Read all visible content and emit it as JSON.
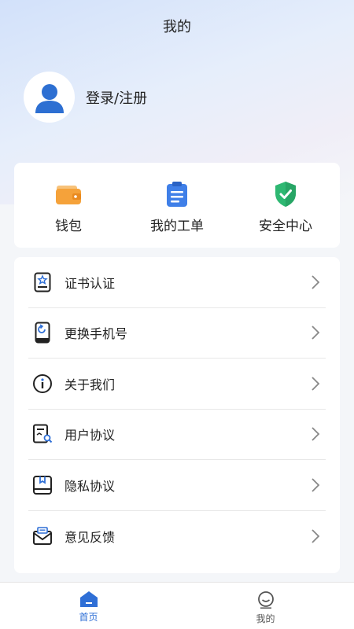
{
  "header": {
    "title": "我的"
  },
  "profile": {
    "login_label": "登录/注册",
    "avatar_icon": "user-avatar-icon"
  },
  "quick_actions": [
    {
      "label": "钱包",
      "icon": "wallet-icon"
    },
    {
      "label": "我的工单",
      "icon": "clipboard-icon"
    },
    {
      "label": "安全中心",
      "icon": "shield-check-icon"
    }
  ],
  "menu": [
    {
      "label": "证书认证",
      "icon": "certificate-icon"
    },
    {
      "label": "更换手机号",
      "icon": "phone-change-icon"
    },
    {
      "label": "关于我们",
      "icon": "info-icon"
    },
    {
      "label": "用户协议",
      "icon": "document-search-icon"
    },
    {
      "label": "隐私协议",
      "icon": "bookmark-book-icon"
    },
    {
      "label": "意见反馈",
      "icon": "mail-icon"
    }
  ],
  "tabbar": [
    {
      "label": "首页",
      "icon": "home-icon",
      "active": true
    },
    {
      "label": "我的",
      "icon": "smiley-icon",
      "active": false
    }
  ],
  "colors": {
    "accent": "#2f6fd6",
    "wallet": "#f5a23a",
    "clipboard": "#3f7fe8",
    "shield": "#2eb872"
  }
}
